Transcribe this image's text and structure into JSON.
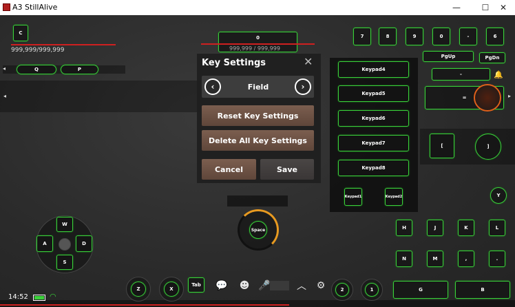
{
  "window": {
    "title": "A3 StillAlive",
    "minimize": "—",
    "maximize": "☐",
    "close": "✕"
  },
  "hud": {
    "player_key": "C",
    "player_hp": "999,999/999,999",
    "target_key": "0",
    "target_hp": "999,999 / 999,999",
    "buff_keys": [
      "Q",
      "P"
    ],
    "top_keys": [
      "7",
      "8",
      "9",
      "0",
      "-",
      "6"
    ],
    "pgup": "PgUp",
    "pgdn": "PgDn",
    "mid_key": "-",
    "equals_key": "=",
    "bracket_left": "[",
    "bracket_right": "]",
    "clock": "14:52"
  },
  "keypad_list": [
    "Keypad4",
    "Keypad5",
    "Keypad6",
    "Keypad7",
    "Keypad8"
  ],
  "keypad_small": [
    "Keypad1",
    "Keypad2"
  ],
  "dialog": {
    "title": "Key Settings",
    "mode": "Field",
    "reset": "Reset Key Settings",
    "delete_all": "Delete All Key Settings",
    "cancel": "Cancel",
    "save": "Save"
  },
  "dpad": {
    "up": "W",
    "left": "A",
    "right": "D",
    "down": "S"
  },
  "space_key": "Space",
  "right_grid": {
    "row1": [
      "H",
      "J",
      "K",
      "L"
    ],
    "row2": [
      "N",
      "M",
      ",",
      "."
    ],
    "y": "Y"
  },
  "bottom_keys": {
    "z": "Z",
    "x": "X",
    "tab": "Tab",
    "two": "2",
    "one": "1",
    "g": "G",
    "b": "B"
  }
}
